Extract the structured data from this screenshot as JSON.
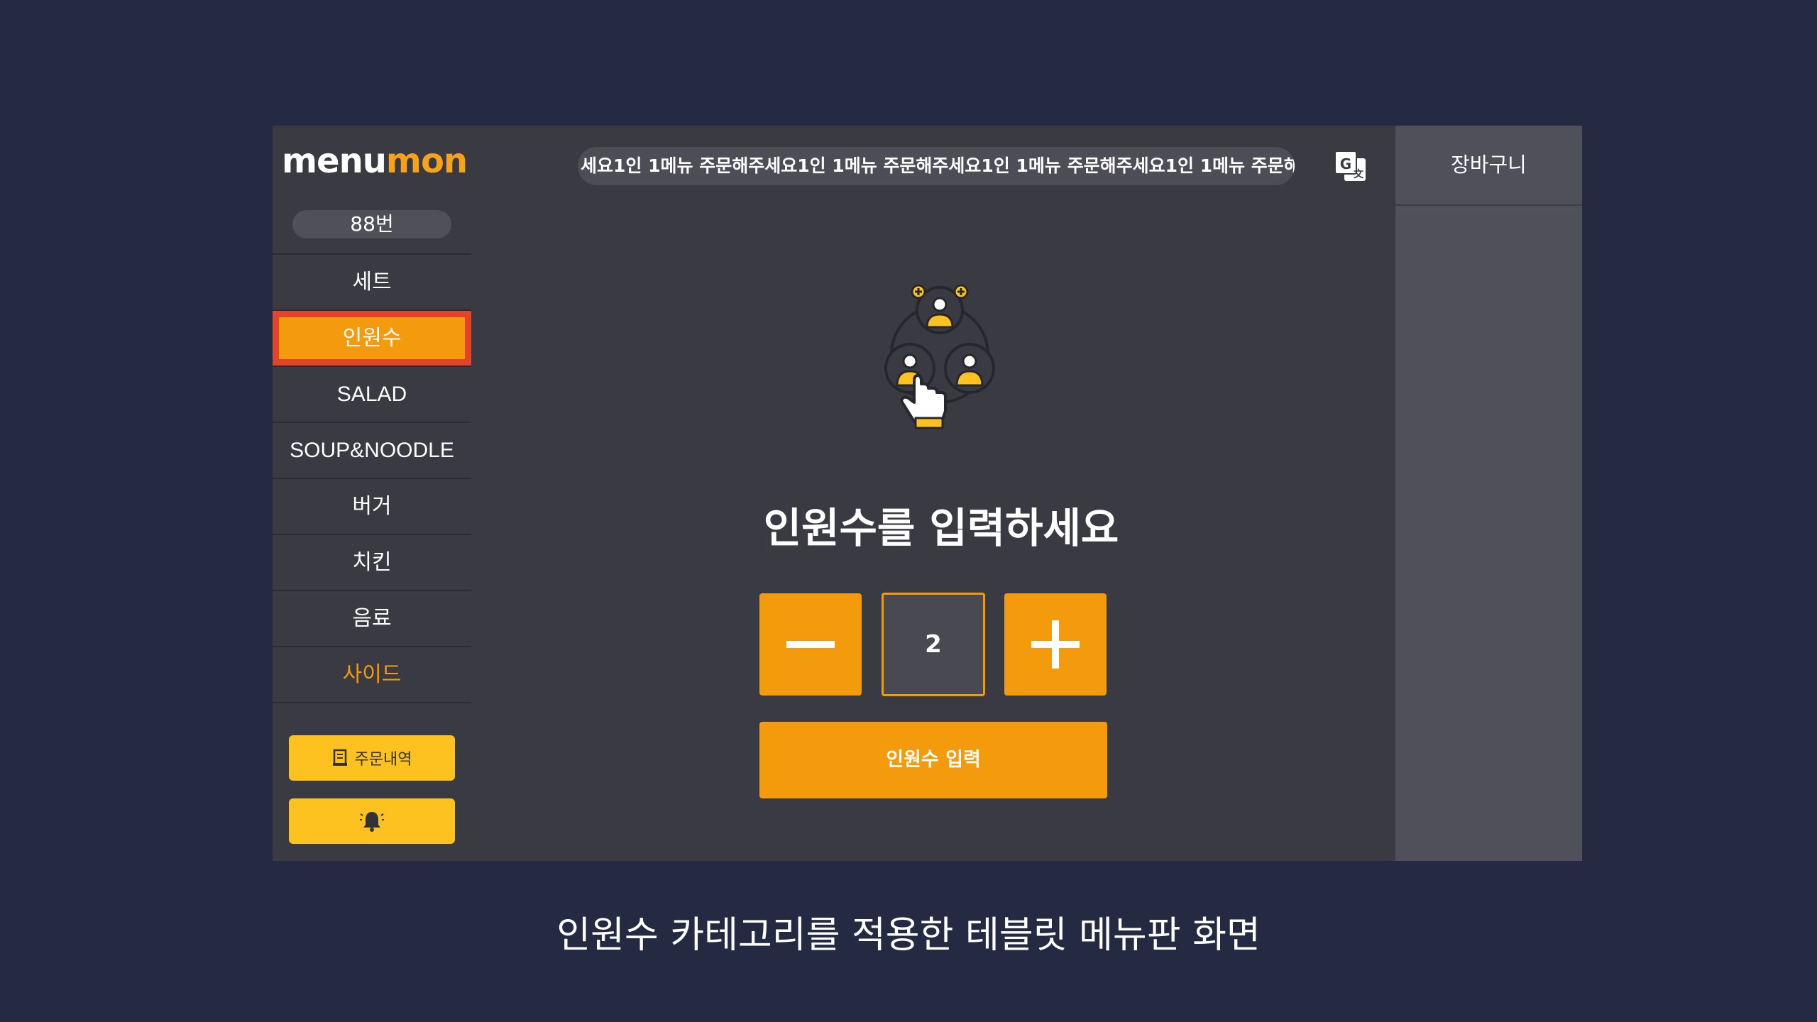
{
  "app": {
    "logo_part1": "menu",
    "logo_part2": "mon",
    "table_number": "88번"
  },
  "sidebar": {
    "categories": [
      {
        "label": "세트"
      },
      {
        "label": "인원수",
        "active": true
      },
      {
        "label": "SALAD"
      },
      {
        "label": "SOUP&NOODLE"
      },
      {
        "label": "버거"
      },
      {
        "label": "치킨"
      },
      {
        "label": "음료"
      },
      {
        "label": "사이드"
      }
    ],
    "order_history_label": "주문내역"
  },
  "header": {
    "marquee_text": "세요1인 1메뉴 주문해주세요1인 1메뉴 주문해주세요1인 1메뉴 주문해주세요1인 1메뉴 주문해주세"
  },
  "main": {
    "prompt": "인원수를 입력하세요",
    "count": "2",
    "submit_label": "인원수 입력"
  },
  "cart": {
    "title": "장바구니"
  },
  "caption": "인원수 카테고리를 적용한 테블릿 메뉴판 화면",
  "colors": {
    "background": "#232a41",
    "panel": "#3a3a43",
    "accent": "#f39a0d",
    "highlight_border": "#e0452a",
    "yellow_button": "#fdc21f"
  },
  "icons": [
    "translate-icon",
    "people-select-icon",
    "receipt-icon",
    "bell-icon"
  ]
}
